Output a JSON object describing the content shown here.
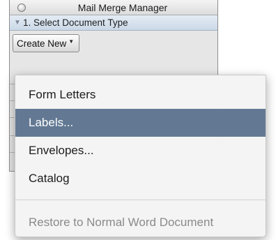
{
  "window": {
    "title": "Mail Merge Manager"
  },
  "section": {
    "disclosure_icon": "triangle-down",
    "title": "1. Select Document Type"
  },
  "create_new": {
    "label": "Create New",
    "caret_icon": "dropdown-caret"
  },
  "menu": {
    "items": [
      {
        "label": "Form Letters",
        "selected": false,
        "enabled": true
      },
      {
        "label": "Labels...",
        "selected": true,
        "enabled": true
      },
      {
        "label": "Envelopes...",
        "selected": false,
        "enabled": true
      },
      {
        "label": "Catalog",
        "selected": false,
        "enabled": true
      }
    ],
    "restore_label": "Restore to Normal Word Document",
    "restore_enabled": false
  },
  "colors": {
    "selection": "#637993",
    "disabled_text": "#8a8a8a",
    "section_header": "#cbd8e6"
  }
}
